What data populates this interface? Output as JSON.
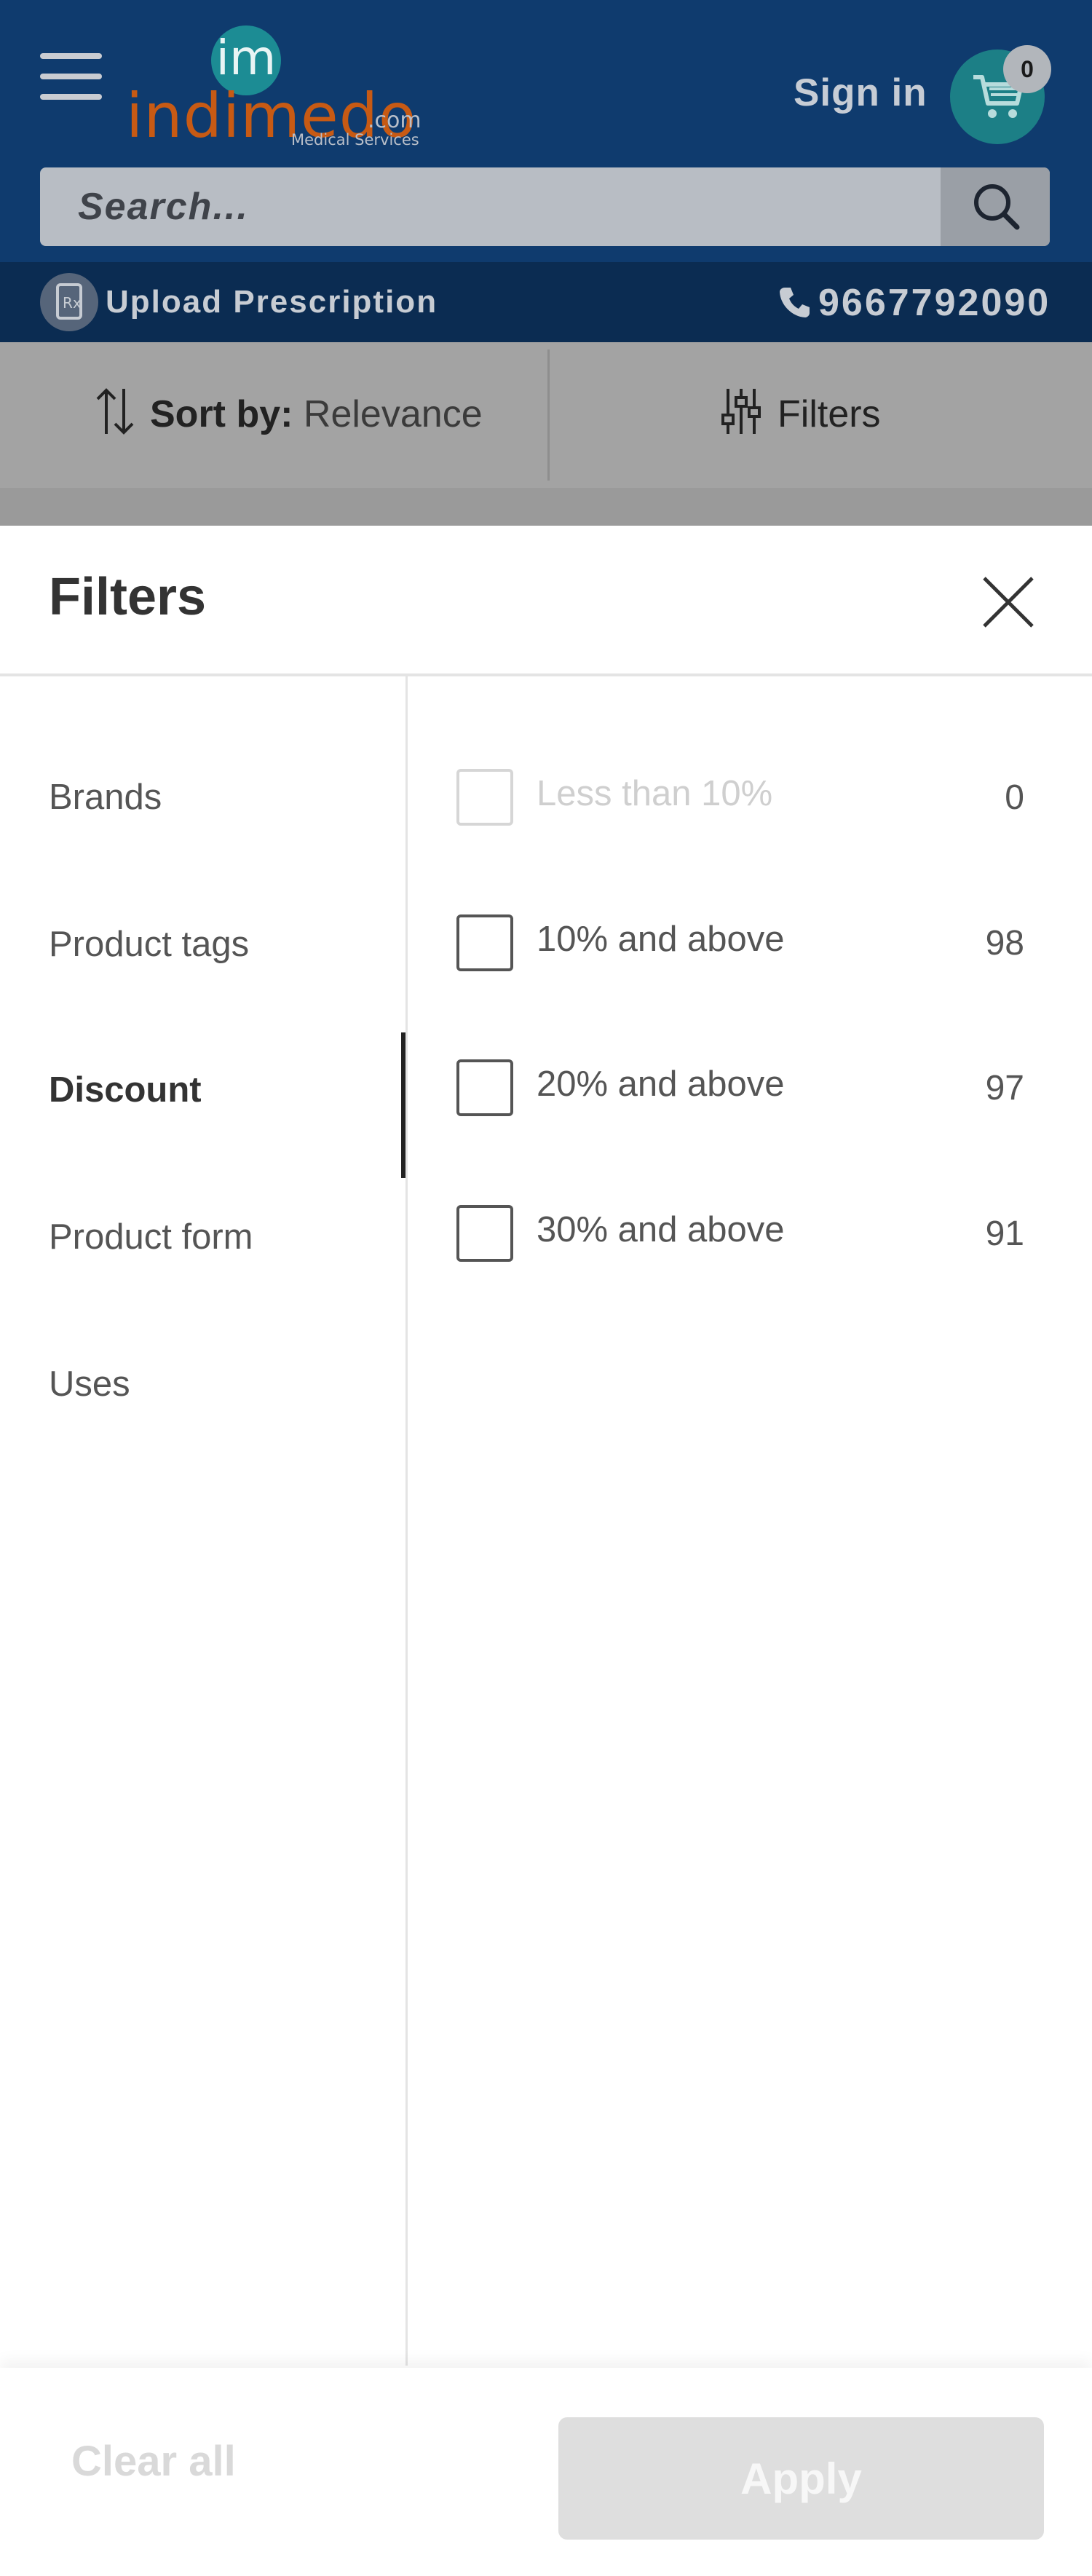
{
  "header": {
    "logo_mark": "im",
    "logo_word": "indimedo",
    "logo_domain": ".com",
    "logo_tagline": "Medical Services",
    "signin_label": "Sign in",
    "cart_count": "0",
    "search_placeholder": "Search...",
    "upload_label": "Upload Prescription",
    "phone": "9667792090"
  },
  "sortbar": {
    "sort_label": "Sort by:",
    "sort_value": "Relevance",
    "filters_label": "Filters"
  },
  "sheet": {
    "title": "Filters",
    "categories": [
      {
        "label": "Brands",
        "active": false
      },
      {
        "label": "Product tags",
        "active": false
      },
      {
        "label": "Discount",
        "active": true
      },
      {
        "label": "Product form",
        "active": false
      },
      {
        "label": "Uses",
        "active": false
      }
    ],
    "options": [
      {
        "label": "Less than 10%",
        "count": "0",
        "disabled": true
      },
      {
        "label": "10% and above",
        "count": "98",
        "disabled": false
      },
      {
        "label": "20% and above",
        "count": "97",
        "disabled": false
      },
      {
        "label": "30% and above",
        "count": "91",
        "disabled": false
      }
    ],
    "clear_label": "Clear all",
    "apply_label": "Apply"
  },
  "colors": {
    "header_bg": "#0f3b6e",
    "upload_bar_bg": "#0b2c52",
    "logo_orange": "#c75a14",
    "logo_teal": "#1c8c94",
    "active_indicator": "#222222",
    "apply_disabled": "#dedede"
  },
  "icons": [
    "menu-icon",
    "cart-icon",
    "search-icon",
    "prescription-icon",
    "phone-icon",
    "sort-icon",
    "filter-sliders-icon",
    "close-icon"
  ]
}
